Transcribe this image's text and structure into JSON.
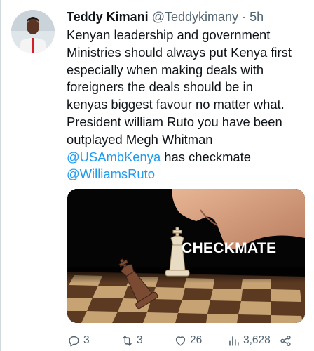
{
  "tweet": {
    "display_name": "Teddy Kimani",
    "handle": "@Teddykimany",
    "separator": "·",
    "time": "5h",
    "lines": [
      "Kenyan leadership and government",
      "Ministries should always put Kenya first",
      "especially when making deals with",
      "foreigners the deals should be in",
      "kenyas biggest favour no matter what.",
      "President william Ruto you have been",
      "outplayed Megh Whitman"
    ],
    "mention_1": "@USAmbKenya",
    "after_mention_1": " has checkmate",
    "mention_2": "@WilliamsRuto",
    "media": {
      "caption": "CHECKMATE",
      "icon": "chess-photo"
    },
    "actions": {
      "replies": "3",
      "retweets": "3",
      "likes": "26",
      "views": "3,628"
    }
  },
  "colors": {
    "text": "#0f1419",
    "secondary": "#536471",
    "link": "#1d9bf0"
  }
}
